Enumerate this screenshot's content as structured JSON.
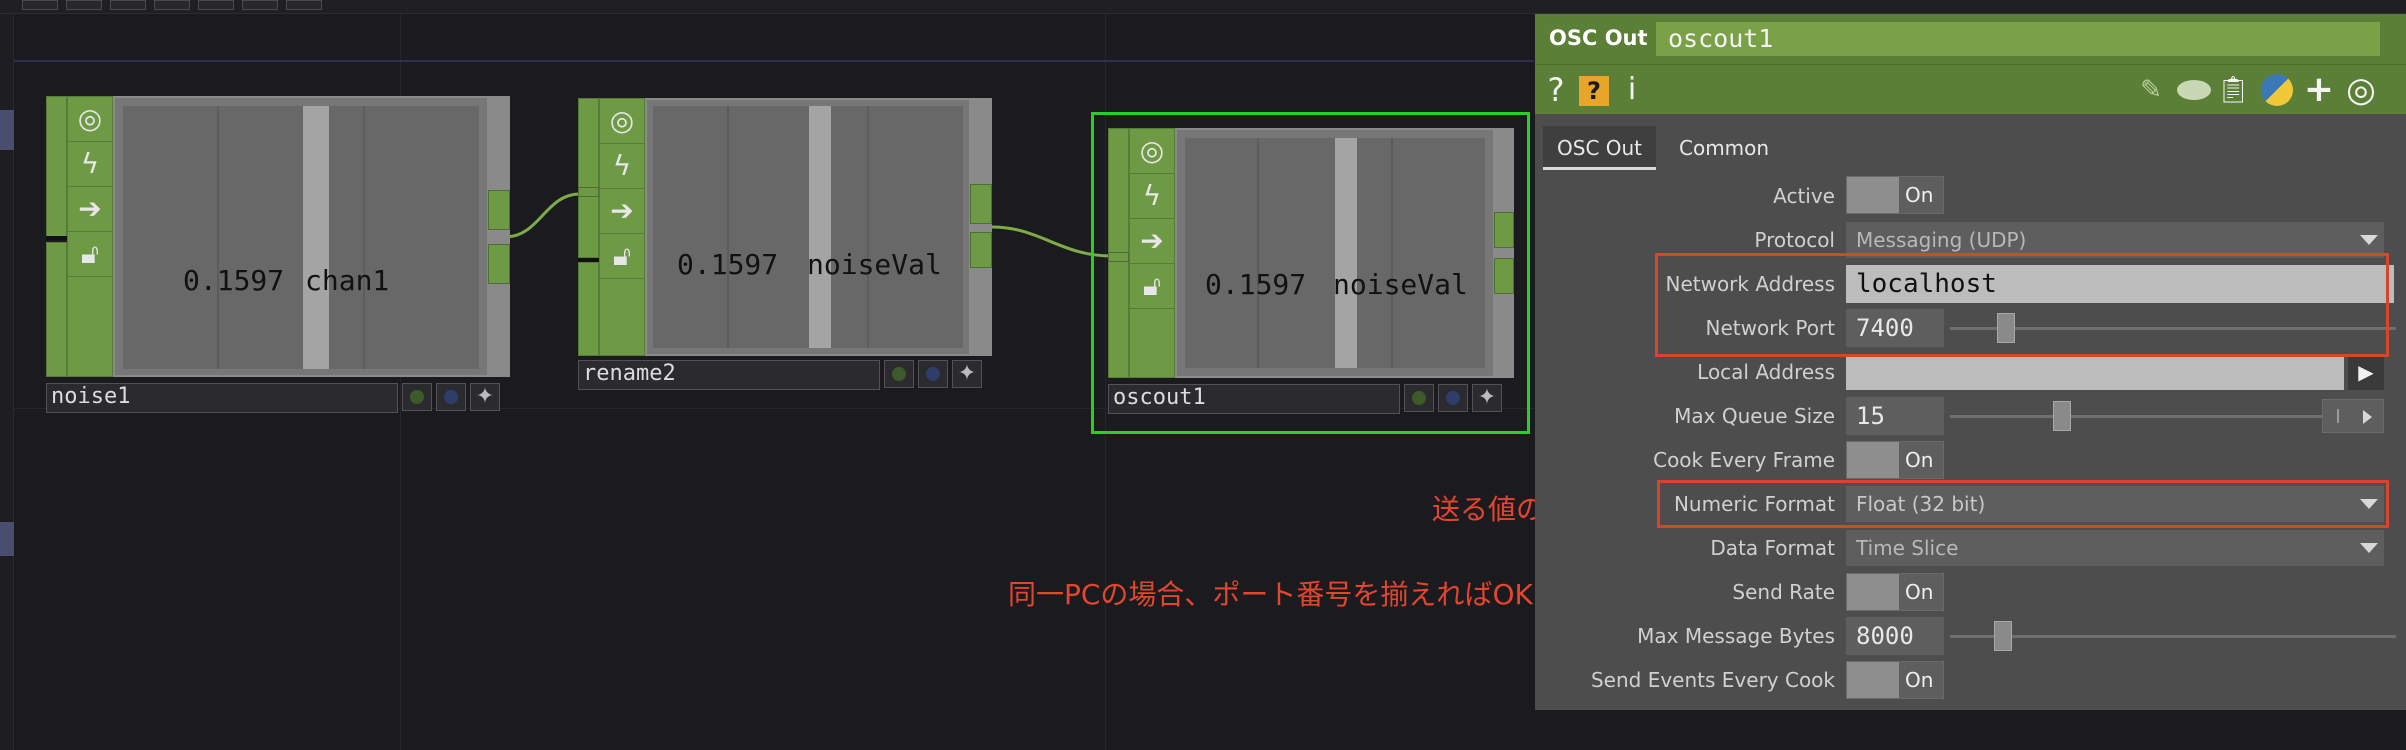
{
  "nodes": [
    {
      "name": "noise1",
      "value": "0.1597",
      "channel": "chan1"
    },
    {
      "name": "rename2",
      "value": "0.1597",
      "channel": "noiseVal"
    },
    {
      "name": "oscout1",
      "value": "0.1597",
      "channel": "noiseVal"
    }
  ],
  "panel": {
    "op_type": "OSC Out",
    "op_name": "oscout1",
    "tabs": [
      "OSC Out",
      "Common"
    ],
    "params": {
      "active": {
        "label": "Active",
        "value": "On"
      },
      "protocol": {
        "label": "Protocol",
        "value": "Messaging (UDP)"
      },
      "network_address": {
        "label": "Network Address",
        "value": "localhost"
      },
      "network_port": {
        "label": "Network Port",
        "value": "7400"
      },
      "local_address": {
        "label": "Local Address",
        "value": ""
      },
      "max_queue_size": {
        "label": "Max Queue Size",
        "value": "15"
      },
      "cook_every_frame": {
        "label": "Cook Every Frame",
        "value": "On"
      },
      "numeric_format": {
        "label": "Numeric Format",
        "value": "Float (32 bit)"
      },
      "data_format": {
        "label": "Data Format",
        "value": "Time Slice"
      },
      "send_rate": {
        "label": "Send Rate",
        "value": "On"
      },
      "max_message_bytes": {
        "label": "Max Message Bytes",
        "value": "8000"
      },
      "send_events_every_cook": {
        "label": "Send Events Every Cook",
        "value": "On"
      }
    }
  },
  "annotations": {
    "numeric_note": "送る値の型",
    "port_note": "同一PCの場合、ポート番号を揃えればOK"
  },
  "icons": {
    "flags": [
      "viewer-icon",
      "bypass-icon",
      "display-icon",
      "lock-icon"
    ],
    "panel_left": [
      "help-icon",
      "python-help-icon",
      "info-icon"
    ],
    "panel_right": [
      "edit-icon",
      "comment-icon",
      "clipboard-icon",
      "python-icon",
      "add-icon",
      "target-icon"
    ]
  },
  "colors": {
    "op_green": "#6e9a46",
    "header_green": "#5b7f37",
    "select_green": "#26d026",
    "annotation_red": "#e3462d"
  }
}
